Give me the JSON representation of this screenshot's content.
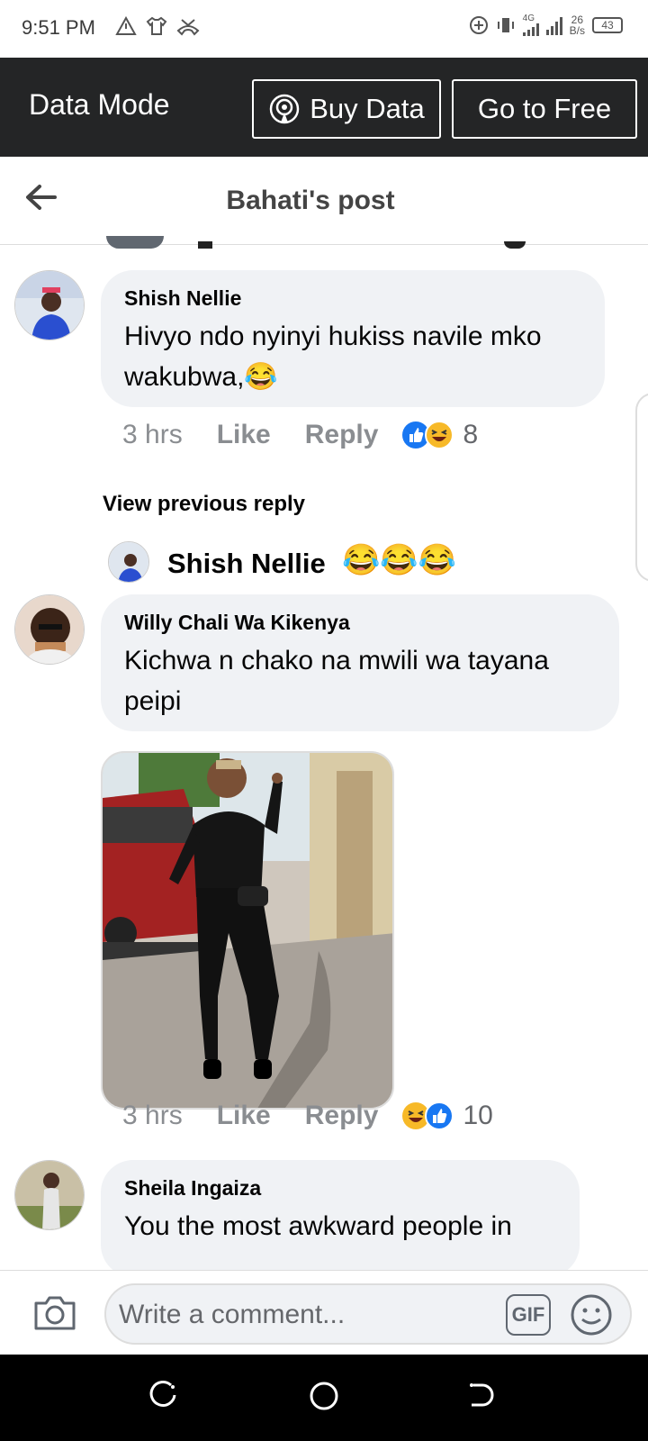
{
  "status_bar": {
    "time": "9:51 PM",
    "network": "4G",
    "speed_value": "26",
    "speed_unit": "B/s",
    "battery": "43"
  },
  "data_mode": {
    "label": "Data Mode",
    "buy_label": "Buy Data",
    "free_label": "Go to Free"
  },
  "header": {
    "title": "Bahati's post"
  },
  "comments": [
    {
      "author": "Shish Nellie",
      "text": "Hivyo ndo nyinyi hukiss navile mko wakubwa,",
      "emoji": "😂",
      "time": "3 hrs",
      "like": "Like",
      "reply": "Reply",
      "reaction_count": "8"
    },
    {
      "author": "Willy Chali Wa Kikenya",
      "text": "Kichwa n chako na mwili wa tayana peipi",
      "time": "3 hrs",
      "like": "Like",
      "reply": "Reply",
      "reaction_count": "10"
    },
    {
      "author": "Sheila Ingaiza",
      "text": "You the most awkward people in"
    }
  ],
  "view_previous_reply": "View previous reply",
  "reply_preview": {
    "author": "Shish Nellie",
    "emoji": "😂😂😂"
  },
  "composer": {
    "placeholder": "Write a comment...",
    "gif_label": "GIF"
  },
  "colors": {
    "data_bar": "#242526",
    "bubble": "#f0f2f5",
    "like_blue": "#1877f2",
    "haha_yellow": "#f7b928"
  }
}
